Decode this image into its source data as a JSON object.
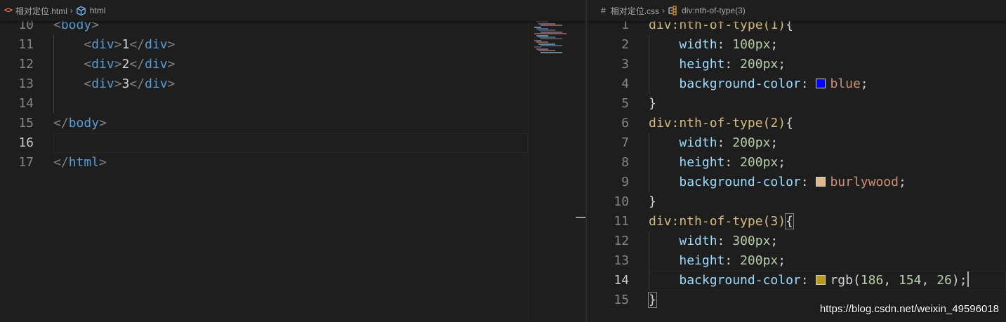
{
  "left_editor": {
    "breadcrumb": {
      "file": "相对定位.html",
      "symbol": "html"
    },
    "lines": [
      {
        "num": "10",
        "tokens": [
          {
            "t": "<",
            "c": "t-punct"
          },
          {
            "t": "body",
            "c": "t-tag"
          },
          {
            "t": ">",
            "c": "t-punct"
          }
        ]
      },
      {
        "num": "11",
        "tokens": [
          {
            "t": "    "
          },
          {
            "t": "<",
            "c": "t-punct"
          },
          {
            "t": "div",
            "c": "t-tag"
          },
          {
            "t": ">",
            "c": "t-punct"
          },
          {
            "t": "1",
            "c": "t-text"
          },
          {
            "t": "</",
            "c": "t-punct"
          },
          {
            "t": "div",
            "c": "t-tag"
          },
          {
            "t": ">",
            "c": "t-punct"
          }
        ]
      },
      {
        "num": "12",
        "tokens": [
          {
            "t": "    "
          },
          {
            "t": "<",
            "c": "t-punct"
          },
          {
            "t": "div",
            "c": "t-tag"
          },
          {
            "t": ">",
            "c": "t-punct"
          },
          {
            "t": "2",
            "c": "t-text"
          },
          {
            "t": "</",
            "c": "t-punct"
          },
          {
            "t": "div",
            "c": "t-tag"
          },
          {
            "t": ">",
            "c": "t-punct"
          }
        ]
      },
      {
        "num": "13",
        "tokens": [
          {
            "t": "    "
          },
          {
            "t": "<",
            "c": "t-punct"
          },
          {
            "t": "div",
            "c": "t-tag"
          },
          {
            "t": ">",
            "c": "t-punct"
          },
          {
            "t": "3",
            "c": "t-text"
          },
          {
            "t": "</",
            "c": "t-punct"
          },
          {
            "t": "div",
            "c": "t-tag"
          },
          {
            "t": ">",
            "c": "t-punct"
          }
        ]
      },
      {
        "num": "14",
        "tokens": []
      },
      {
        "num": "15",
        "tokens": [
          {
            "t": "</",
            "c": "t-punct"
          },
          {
            "t": "body",
            "c": "t-tag"
          },
          {
            "t": ">",
            "c": "t-punct"
          }
        ]
      },
      {
        "num": "16",
        "tokens": [],
        "current": true
      },
      {
        "num": "17",
        "tokens": [
          {
            "t": "</",
            "c": "t-punct"
          },
          {
            "t": "html",
            "c": "t-tag"
          },
          {
            "t": ">",
            "c": "t-punct"
          }
        ]
      }
    ]
  },
  "right_editor": {
    "breadcrumb": {
      "file": "相对定位.css",
      "symbol": "div:nth-of-type(3)"
    },
    "lines": [
      {
        "num": "1",
        "tokens": [
          {
            "t": "div:nth-of-type(1)",
            "c": "t-sel"
          },
          {
            "t": "{",
            "c": "t-brace"
          }
        ]
      },
      {
        "num": "2",
        "tokens": [
          {
            "t": "    "
          },
          {
            "t": "width",
            "c": "t-prop"
          },
          {
            "t": ": ",
            "c": "t-text"
          },
          {
            "t": "100px",
            "c": "t-num"
          },
          {
            "t": ";",
            "c": "t-text"
          }
        ]
      },
      {
        "num": "3",
        "tokens": [
          {
            "t": "    "
          },
          {
            "t": "height",
            "c": "t-prop"
          },
          {
            "t": ": ",
            "c": "t-text"
          },
          {
            "t": "200px",
            "c": "t-num"
          },
          {
            "t": ";",
            "c": "t-text"
          }
        ]
      },
      {
        "num": "4",
        "tokens": [
          {
            "t": "    "
          },
          {
            "t": "background-color",
            "c": "t-prop"
          },
          {
            "t": ": ",
            "c": "t-text"
          },
          {
            "swatch": "#0000ff"
          },
          {
            "t": "blue",
            "c": "t-val"
          },
          {
            "t": ";",
            "c": "t-text"
          }
        ]
      },
      {
        "num": "5",
        "tokens": [
          {
            "t": "}",
            "c": "t-brace"
          }
        ]
      },
      {
        "num": "6",
        "tokens": [
          {
            "t": "div:nth-of-type(2)",
            "c": "t-sel"
          },
          {
            "t": "{",
            "c": "t-brace"
          }
        ]
      },
      {
        "num": "7",
        "tokens": [
          {
            "t": "    "
          },
          {
            "t": "width",
            "c": "t-prop"
          },
          {
            "t": ": ",
            "c": "t-text"
          },
          {
            "t": "200px",
            "c": "t-num"
          },
          {
            "t": ";",
            "c": "t-text"
          }
        ]
      },
      {
        "num": "8",
        "tokens": [
          {
            "t": "    "
          },
          {
            "t": "height",
            "c": "t-prop"
          },
          {
            "t": ": ",
            "c": "t-text"
          },
          {
            "t": "200px",
            "c": "t-num"
          },
          {
            "t": ";",
            "c": "t-text"
          }
        ]
      },
      {
        "num": "9",
        "tokens": [
          {
            "t": "    "
          },
          {
            "t": "background-color",
            "c": "t-prop"
          },
          {
            "t": ": ",
            "c": "t-text"
          },
          {
            "swatch": "#deb887"
          },
          {
            "t": "burlywood",
            "c": "t-val"
          },
          {
            "t": ";",
            "c": "t-text"
          }
        ]
      },
      {
        "num": "10",
        "tokens": [
          {
            "t": "}",
            "c": "t-brace"
          }
        ]
      },
      {
        "num": "11",
        "tokens": [
          {
            "t": "div:nth-of-type(3)",
            "c": "t-sel"
          },
          {
            "t": "{",
            "c": "t-brace",
            "match": true
          }
        ]
      },
      {
        "num": "12",
        "tokens": [
          {
            "t": "    "
          },
          {
            "t": "width",
            "c": "t-prop"
          },
          {
            "t": ": ",
            "c": "t-text"
          },
          {
            "t": "300px",
            "c": "t-num"
          },
          {
            "t": ";",
            "c": "t-text"
          }
        ]
      },
      {
        "num": "13",
        "tokens": [
          {
            "t": "    "
          },
          {
            "t": "height",
            "c": "t-prop"
          },
          {
            "t": ": ",
            "c": "t-text"
          },
          {
            "t": "200px",
            "c": "t-num"
          },
          {
            "t": ";",
            "c": "t-text"
          }
        ]
      },
      {
        "num": "14",
        "current": true,
        "cursor": true,
        "tokens": [
          {
            "t": "    "
          },
          {
            "t": "background-color",
            "c": "t-prop"
          },
          {
            "t": ": ",
            "c": "t-text"
          },
          {
            "swatch": "#ba9a1a"
          },
          {
            "t": "rgb(",
            "c": "t-text"
          },
          {
            "t": "186",
            "c": "t-num"
          },
          {
            "t": ", ",
            "c": "t-text"
          },
          {
            "t": "154",
            "c": "t-num"
          },
          {
            "t": ", ",
            "c": "t-text"
          },
          {
            "t": "26",
            "c": "t-num"
          },
          {
            "t": ");",
            "c": "t-text"
          }
        ]
      },
      {
        "num": "15",
        "tokens": [
          {
            "t": "}",
            "c": "t-brace",
            "match": true
          }
        ]
      }
    ]
  },
  "watermark": "https://blog.csdn.net/weixin_49596018",
  "icons": {
    "html_file": "<>",
    "css_file": "#"
  },
  "colors": {
    "tag": "#569cd6",
    "selector": "#d7ba7d",
    "property": "#9cdcfe",
    "number": "#b5cea8",
    "string": "#ce9178"
  }
}
